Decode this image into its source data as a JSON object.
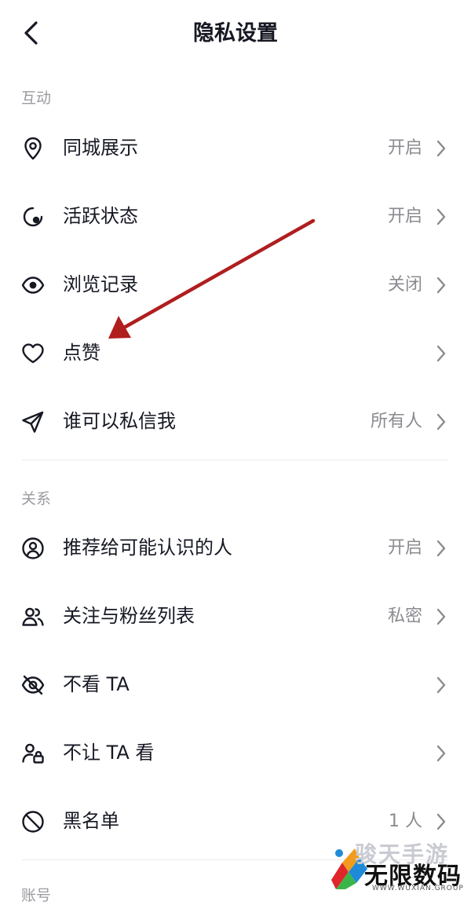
{
  "header": {
    "title": "隐私设置"
  },
  "sections": [
    {
      "label": "互动",
      "items": [
        {
          "icon": "location-pin-icon",
          "label": "同城展示",
          "value": "开启"
        },
        {
          "icon": "activity-status-icon",
          "label": "活跃状态",
          "value": "开启"
        },
        {
          "icon": "eye-icon",
          "label": "浏览记录",
          "value": "关闭"
        },
        {
          "icon": "heart-icon",
          "label": "点赞",
          "value": ""
        },
        {
          "icon": "paper-plane-icon",
          "label": "谁可以私信我",
          "value": "所有人"
        }
      ]
    },
    {
      "label": "关系",
      "items": [
        {
          "icon": "user-circle-icon",
          "label": "推荐给可能认识的人",
          "value": "开启"
        },
        {
          "icon": "users-icon",
          "label": "关注与粉丝列表",
          "value": "私密"
        },
        {
          "icon": "eye-off-icon",
          "label": "不看 TA",
          "value": ""
        },
        {
          "icon": "user-lock-icon",
          "label": "不让 TA 看",
          "value": ""
        },
        {
          "icon": "block-icon",
          "label": "黑名单",
          "value": "1 人"
        }
      ]
    },
    {
      "label": "账号"
    }
  ],
  "annotation": {
    "color": "#b01e1e"
  },
  "watermark": {
    "top_text": "骏天手游",
    "main_text": "无限数码",
    "url": "WWW.WUXIAN.GROUP"
  }
}
